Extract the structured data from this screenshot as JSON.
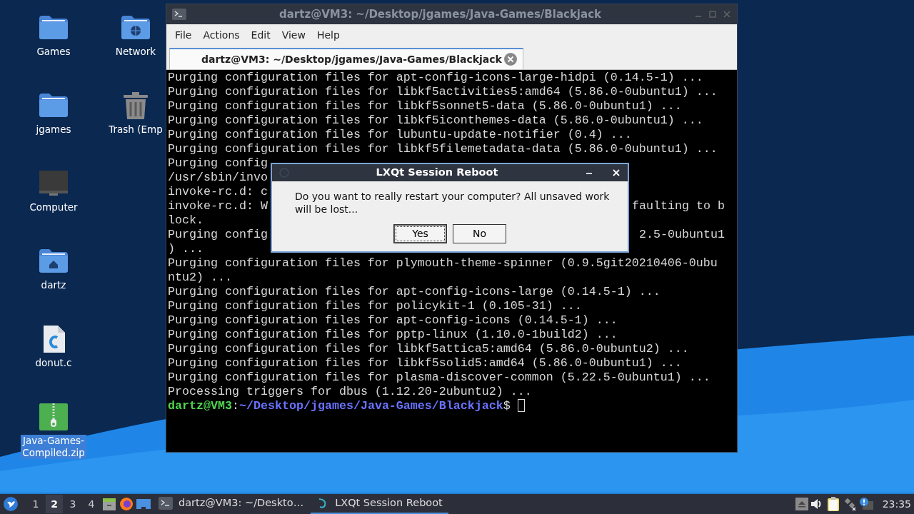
{
  "desktop": {
    "columns": [
      [
        {
          "label": "Games",
          "kind": "folder",
          "selected": false
        },
        {
          "label": "jgames",
          "kind": "folder",
          "selected": false
        },
        {
          "label": "Computer",
          "kind": "computer",
          "selected": false
        },
        {
          "label": "dartz",
          "kind": "home",
          "selected": false
        },
        {
          "label": "donut.c",
          "kind": "source",
          "selected": false
        },
        {
          "label": "Java-Games-\nCompiled.zip",
          "kind": "zip",
          "selected": true
        }
      ],
      [
        {
          "label": "Network",
          "kind": "network",
          "selected": false
        },
        {
          "label": "Trash (Emp",
          "kind": "trash",
          "selected": false
        }
      ]
    ]
  },
  "terminal": {
    "title": "dartz@VM3: ~/Desktop/jgames/Java-Games/Blackjack",
    "menu": [
      "File",
      "Actions",
      "Edit",
      "View",
      "Help"
    ],
    "tab": {
      "label": "dartz@VM3: ~/Desktop/jgames/Java-Games/Blackjack",
      "selected": true
    },
    "lines": [
      {
        "text": "Purging configuration files for apt-config-icons-large-hidpi (0.14.5-1) ..."
      },
      {
        "text": "Purging configuration files for libkf5activities5:amd64 (5.86.0-0ubuntu1) ..."
      },
      {
        "text": "Purging configuration files for libkf5sonnet5-data (5.86.0-0ubuntu1) ..."
      },
      {
        "text": "Purging configuration files for libkf5iconthemes-data (5.86.0-0ubuntu1) ..."
      },
      {
        "text": "Purging configuration files for lubuntu-update-notifier (0.4) ..."
      },
      {
        "text": "Purging configuration files for libkf5filemetadata-data (5.86.0-0ubuntu1) ..."
      },
      {
        "text": "Purging config"
      },
      {
        "text": "/usr/sbin/invo"
      },
      {
        "text": "invoke-rc.d: c"
      },
      {
        "text": "invoke-rc.d: W",
        "right": "faulting to b"
      },
      {
        "text": "lock."
      },
      {
        "text": "Purging config",
        "right": "2.5-0ubuntu1"
      },
      {
        "text": ") ..."
      },
      {
        "text": "Purging configuration files for plymouth-theme-spinner (0.9.5git20210406-0ubu"
      },
      {
        "text": "ntu2) ..."
      },
      {
        "text": "Purging configuration files for apt-config-icons-large (0.14.5-1) ..."
      },
      {
        "text": "Purging configuration files for policykit-1 (0.105-31) ..."
      },
      {
        "text": "Purging configuration files for apt-config-icons (0.14.5-1) ..."
      },
      {
        "text": "Purging configuration files for pptp-linux (1.10.0-1build2) ..."
      },
      {
        "text": "Purging configuration files for libkf5attica5:amd64 (5.86.0-0ubuntu2) ..."
      },
      {
        "text": "Purging configuration files for libkf5solid5:amd64 (5.86.0-0ubuntu1) ..."
      },
      {
        "text": "Purging configuration files for plasma-discover-common (5.22.5-0ubuntu1) ..."
      },
      {
        "text": "Processing triggers for dbus (1.12.20-2ubuntu2) ..."
      }
    ],
    "prompt": {
      "user_host": "dartz@VM3",
      "separator": ":",
      "path": "~/Desktop/jgames/Java-Games/Blackjack",
      "symbol": "$"
    }
  },
  "dialog": {
    "title": "LXQt Session Reboot",
    "message": "Do you want to really restart your computer? All unsaved work will be lost...",
    "buttons": [
      {
        "label": "Yes",
        "focused": true
      },
      {
        "label": "No",
        "focused": false
      }
    ]
  },
  "taskbar": {
    "desktops": [
      {
        "label": "1",
        "selected": false
      },
      {
        "label": "2",
        "selected": true
      },
      {
        "label": "3",
        "selected": false
      },
      {
        "label": "4",
        "selected": false
      }
    ],
    "tasks": [
      {
        "label": "dartz@VM3: ~/Deskto…",
        "kind": "terminal",
        "active": false
      },
      {
        "label": "LXQt Session Reboot",
        "kind": "dialog",
        "active": true
      }
    ],
    "clock": "23:35"
  }
}
